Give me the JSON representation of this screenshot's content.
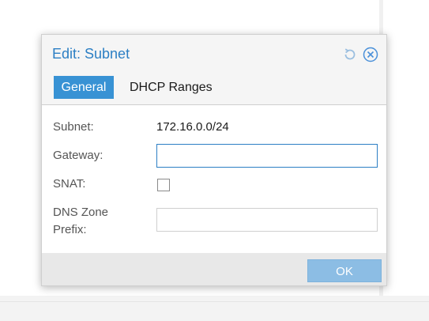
{
  "dialog": {
    "title": "Edit: Subnet",
    "tools": {
      "refresh_icon": "refresh-icon",
      "close_icon": "close-circle-icon"
    }
  },
  "tabs": [
    {
      "label": "General",
      "active": true
    },
    {
      "label": "DHCP Ranges",
      "active": false
    }
  ],
  "form": {
    "subnet_label": "Subnet:",
    "subnet_value": "172.16.0.0/24",
    "gateway_label": "Gateway:",
    "gateway_value": "",
    "snat_label": "SNAT:",
    "snat_checked": false,
    "dns_label_line1": "DNS Zone",
    "dns_label_line2": "Prefix:",
    "dns_value": ""
  },
  "footer": {
    "ok_label": "OK"
  },
  "colors": {
    "accent": "#3892d4",
    "title": "#2c7fc4",
    "ok_disabled": "#8cbde4"
  }
}
